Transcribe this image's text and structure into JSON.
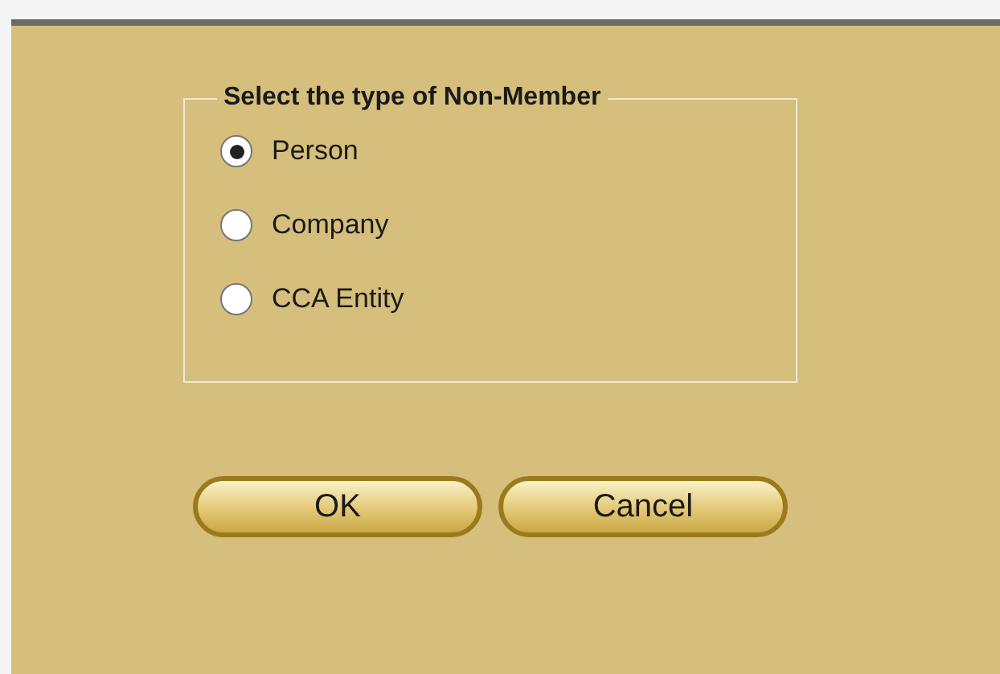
{
  "group": {
    "legend": "Select the type of Non-Member",
    "options": [
      {
        "label": "Person",
        "selected": true
      },
      {
        "label": "Company",
        "selected": false
      },
      {
        "label": "CCA Entity",
        "selected": false
      }
    ]
  },
  "buttons": [
    "OK",
    "Cancel"
  ]
}
